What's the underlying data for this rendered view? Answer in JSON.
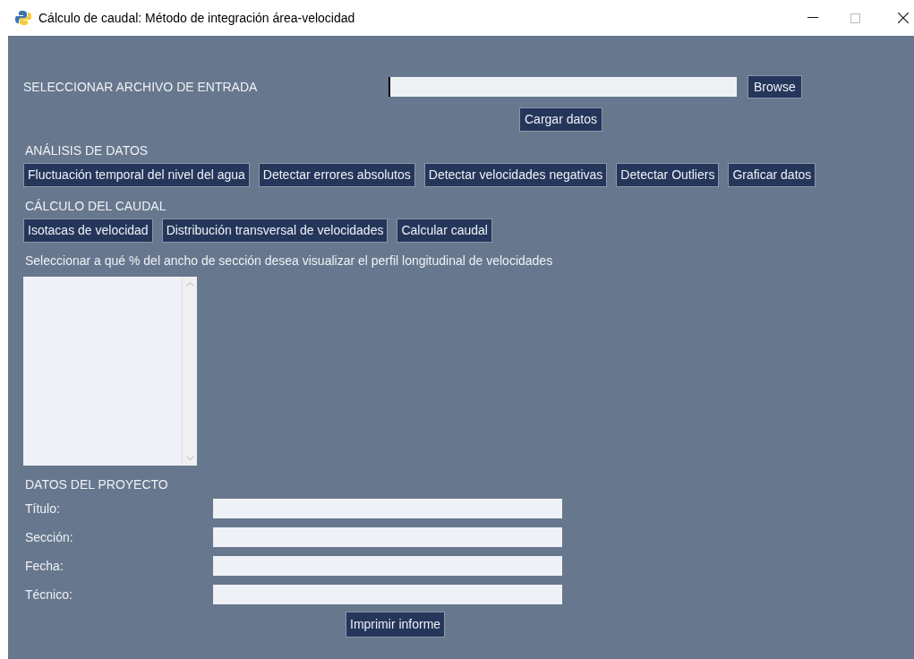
{
  "window": {
    "title": "Cálculo de caudal: Método de integración área-velocidad"
  },
  "file": {
    "label": "SELECCIONAR ARCHIVO DE ENTRADA",
    "focused": true,
    "browse": "Browse",
    "load": "Cargar datos"
  },
  "analysis": {
    "heading": "ANÁLISIS DE DATOS",
    "buttons": [
      "Fluctuación temporal del nivel del agua",
      "Detectar errores absolutos",
      "Detectar velocidades negativas",
      "Detectar Outliers",
      "Graficar datos"
    ]
  },
  "flow": {
    "heading": "CÁLCULO DEL CAUDAL",
    "buttons": [
      "Isotacas de velocidad",
      "Distribución transversal de velocidades",
      "Calcular caudal"
    ],
    "prompt": "Seleccionar a qué % del ancho de sección desea visualizar el perfil longitudinal de velocidades"
  },
  "project": {
    "heading": "DATOS DEL PROYECTO",
    "fields": [
      {
        "label": "Título:"
      },
      {
        "label": "Sección:"
      },
      {
        "label": "Fecha:"
      },
      {
        "label": "Técnico:"
      }
    ],
    "print": "Imprimir informe"
  }
}
